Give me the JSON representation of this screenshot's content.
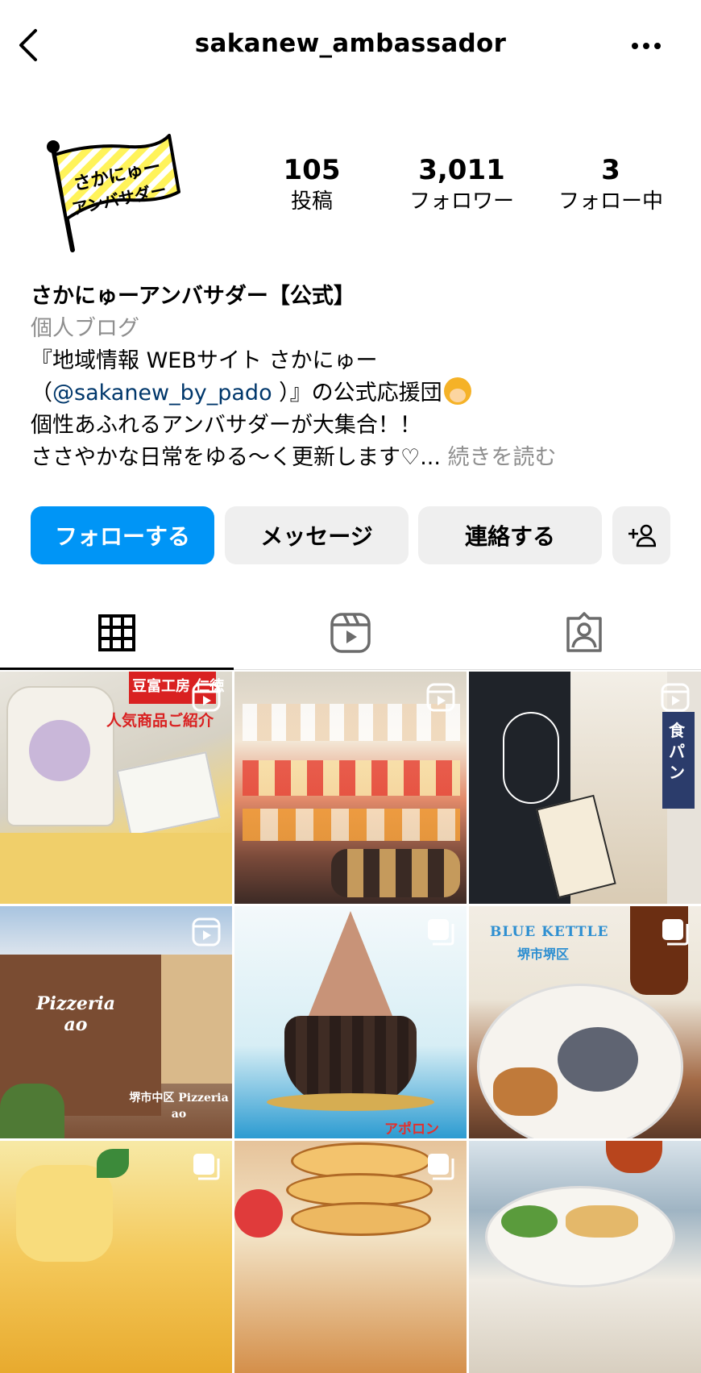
{
  "header": {
    "username": "sakanew_ambassador"
  },
  "profile": {
    "avatar_text": "さかにゅー アンバサダー",
    "stats": [
      {
        "value": "105",
        "label": "投稿"
      },
      {
        "value": "3,011",
        "label": "フォロワー"
      },
      {
        "value": "3",
        "label": "フォロー中"
      }
    ],
    "display_name": "さかにゅーアンバサダー【公式】",
    "category": "個人ブログ",
    "bio_line1": "『地域情報 WEBサイト さかにゅー",
    "bio_line2_open": "（",
    "bio_mention": "@sakanew_by_pado",
    "bio_line2_close": " ）』の公式応援団",
    "bio_line3": "個性あふれるアンバサダーが大集合！！",
    "bio_line4": "ささやかな日常をゆる〜く更新します♡...",
    "more_label": " 続きを読む"
  },
  "actions": {
    "follow": "フォローする",
    "message": "メッセージ",
    "contact": "連絡する"
  },
  "tabs": [
    "grid-icon",
    "reels-icon",
    "tagged-icon"
  ],
  "posts": [
    {
      "caption_top": "豆富工房 仁徳",
      "caption_sub": "人気商品ご紹介",
      "type": "reel"
    },
    {
      "caption_top": "",
      "caption_sub": "",
      "type": "reel"
    },
    {
      "caption_top": "食パン",
      "caption_sub": "",
      "type": "reel"
    },
    {
      "caption_top": "Pizzeria ao",
      "caption_sub": "堺市中区 Pizzeria ao",
      "type": "reel"
    },
    {
      "caption_top": "アポロン",
      "caption_sub": "",
      "type": "carousel"
    },
    {
      "caption_top": "BLUE KETTLE",
      "caption_sub": "堺市堺区",
      "type": "carousel"
    },
    {
      "caption_top": "",
      "caption_sub": "",
      "type": "carousel"
    },
    {
      "caption_top": "",
      "caption_sub": "",
      "type": "carousel"
    },
    {
      "caption_top": "",
      "caption_sub": "",
      "type": "none"
    }
  ],
  "colors": {
    "accent": "#0095f6",
    "secondary_button": "#efefef",
    "mention": "#00376b",
    "muted": "#8e8e8e"
  }
}
